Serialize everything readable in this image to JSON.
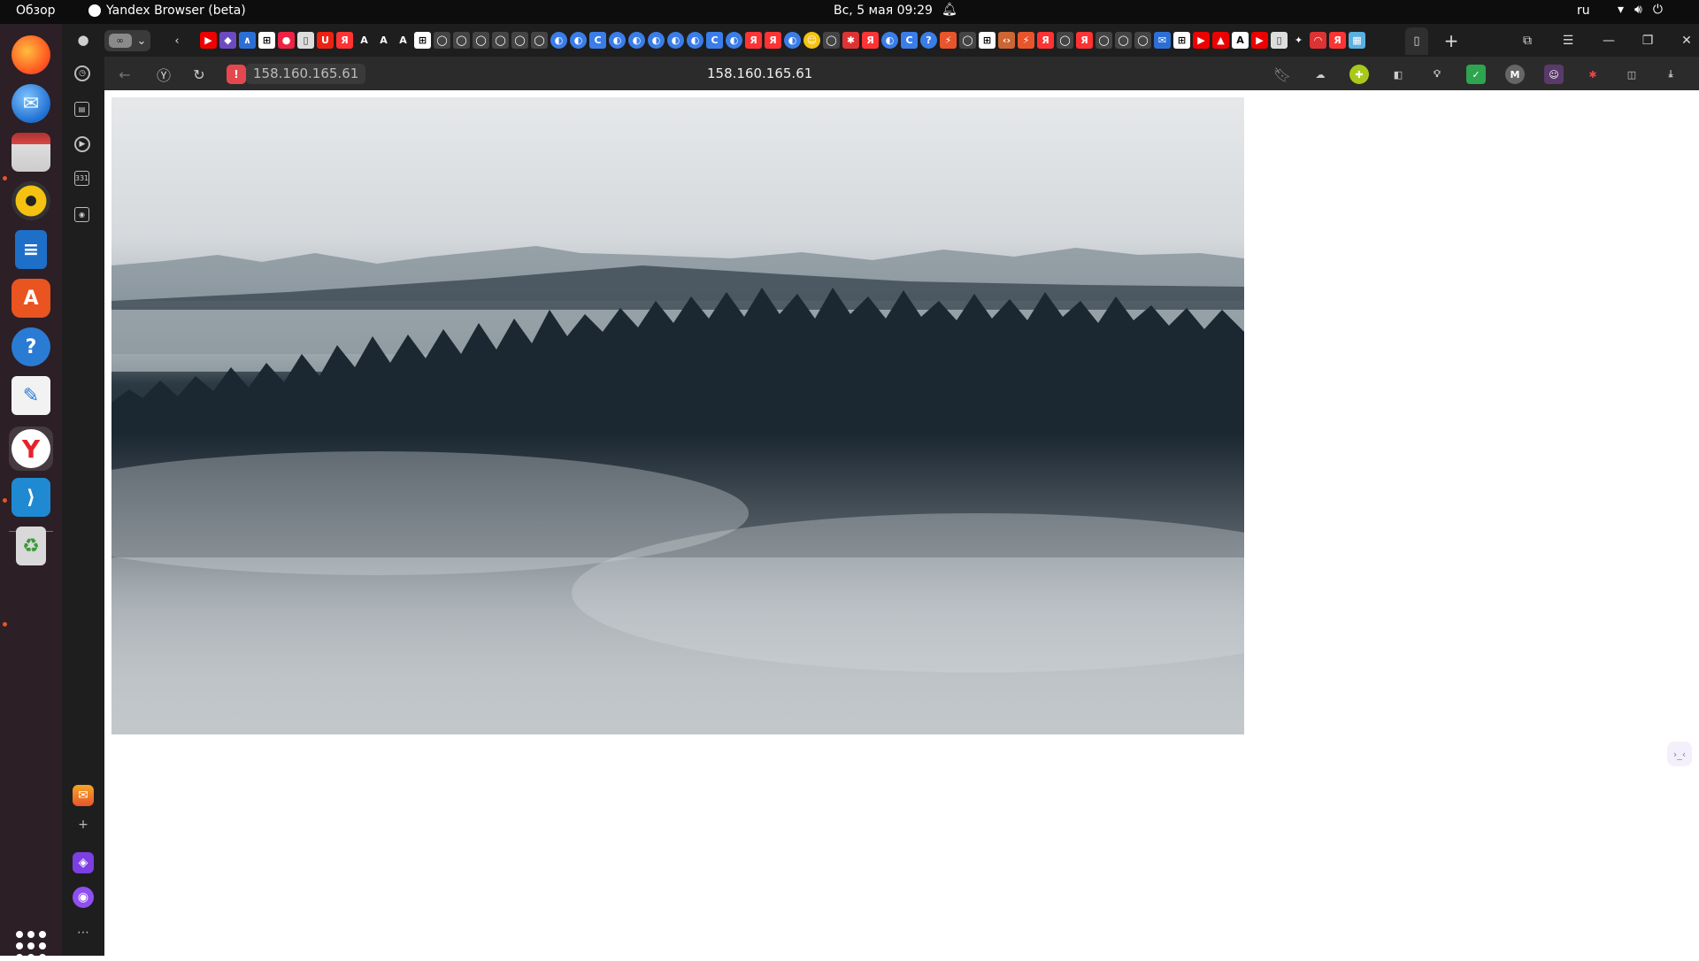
{
  "system_bar": {
    "activities": "Обзор",
    "app_name": "Yandex Browser (beta)",
    "clock": "Вс, 5 мая  09:29",
    "language": "ru"
  },
  "dock": {
    "apps": [
      "firefox",
      "thunderbird",
      "files",
      "rhythmbox",
      "libreoffice-writer",
      "app-center",
      "help",
      "text-editor",
      "yandex-browser",
      "vscode",
      "trash"
    ],
    "show_apps": "show-applications"
  },
  "browser": {
    "tab_switcher_label": "∞",
    "address_chip": "158.160.165.61",
    "address_center": "158.160.165.61",
    "side_panel_counter": "331",
    "accent_color": "#e4484e"
  },
  "page": {
    "image_subject": "foggy forest landscape",
    "side_widget": "›_‹"
  }
}
